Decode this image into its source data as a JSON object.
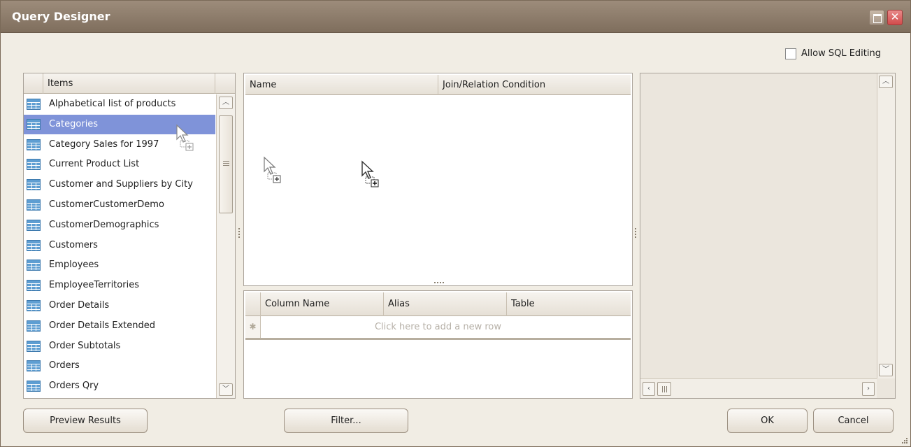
{
  "window": {
    "title": "Query Designer"
  },
  "options": {
    "allow_sql_editing_label": "Allow SQL Editing",
    "allow_sql_editing_checked": false
  },
  "items_panel": {
    "header": "Items",
    "selected_index": 1,
    "items": [
      "Alphabetical list of products",
      "Categories",
      "Category Sales for 1997",
      "Current Product List",
      "Customer and Suppliers by City",
      "CustomerCustomerDemo",
      "CustomerDemographics",
      "Customers",
      "Employees",
      "EmployeeTerritories",
      "Order Details",
      "Order Details Extended",
      "Order Subtotals",
      "Orders",
      "Orders Qry"
    ]
  },
  "relations_panel": {
    "columns": [
      "Name",
      "Join/Relation Condition"
    ]
  },
  "columns_panel": {
    "columns": [
      "Column Name",
      "Alias",
      "Table"
    ],
    "new_row_prompt": "Click here to add a new row"
  },
  "buttons": {
    "preview_results": "Preview Results",
    "filter": "Filter...",
    "ok": "OK",
    "cancel": "Cancel"
  },
  "icons": {
    "table": "table-icon",
    "drag_cursor": "drag-add-cursor-icon",
    "maximize": "maximize-icon",
    "close": "close-icon"
  },
  "colors": {
    "title_bar": "#8f7e6d",
    "selection": "#7f93d9",
    "table_icon": "#5e9ed2",
    "close_button": "#d24b4b"
  }
}
